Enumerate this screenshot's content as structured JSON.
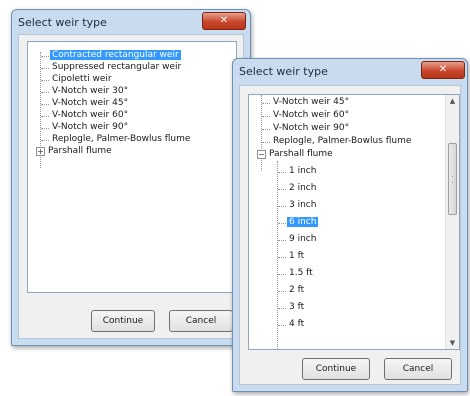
{
  "dialog1": {
    "title": "Select weir type",
    "close_label": "✕",
    "items": [
      "Contracted rectangular weir",
      "Suppressed rectangular weir",
      "Cipoletti weir",
      "V-Notch weir 30°",
      "V-Notch weir 45°",
      "V-Notch weir 60°",
      "V-Notch weir 90°",
      "Replogle, Palmer-Bowlus flume",
      "Parshall flume"
    ],
    "selected_item": "Contracted rectangular weir",
    "parshall_expander": "+",
    "continue_label": "Continue",
    "cancel_label": "Cancel"
  },
  "dialog2": {
    "title": "Select weir type",
    "close_label": "✕",
    "items": [
      "V-Notch weir 45°",
      "V-Notch weir 60°",
      "V-Notch weir 90°",
      "Replogle, Palmer-Bowlus flume",
      "Parshall flume"
    ],
    "parshall_expander": "−",
    "parshall_children": [
      "1 inch",
      "2 inch",
      "3 inch",
      "6 inch",
      "9 inch",
      "1 ft",
      "1.5 ft",
      "2 ft",
      "3 ft",
      "4 ft"
    ],
    "selected_item": "6 inch",
    "scroll_up": "▲",
    "scroll_down": "▼",
    "continue_label": "Continue",
    "cancel_label": "Cancel"
  }
}
